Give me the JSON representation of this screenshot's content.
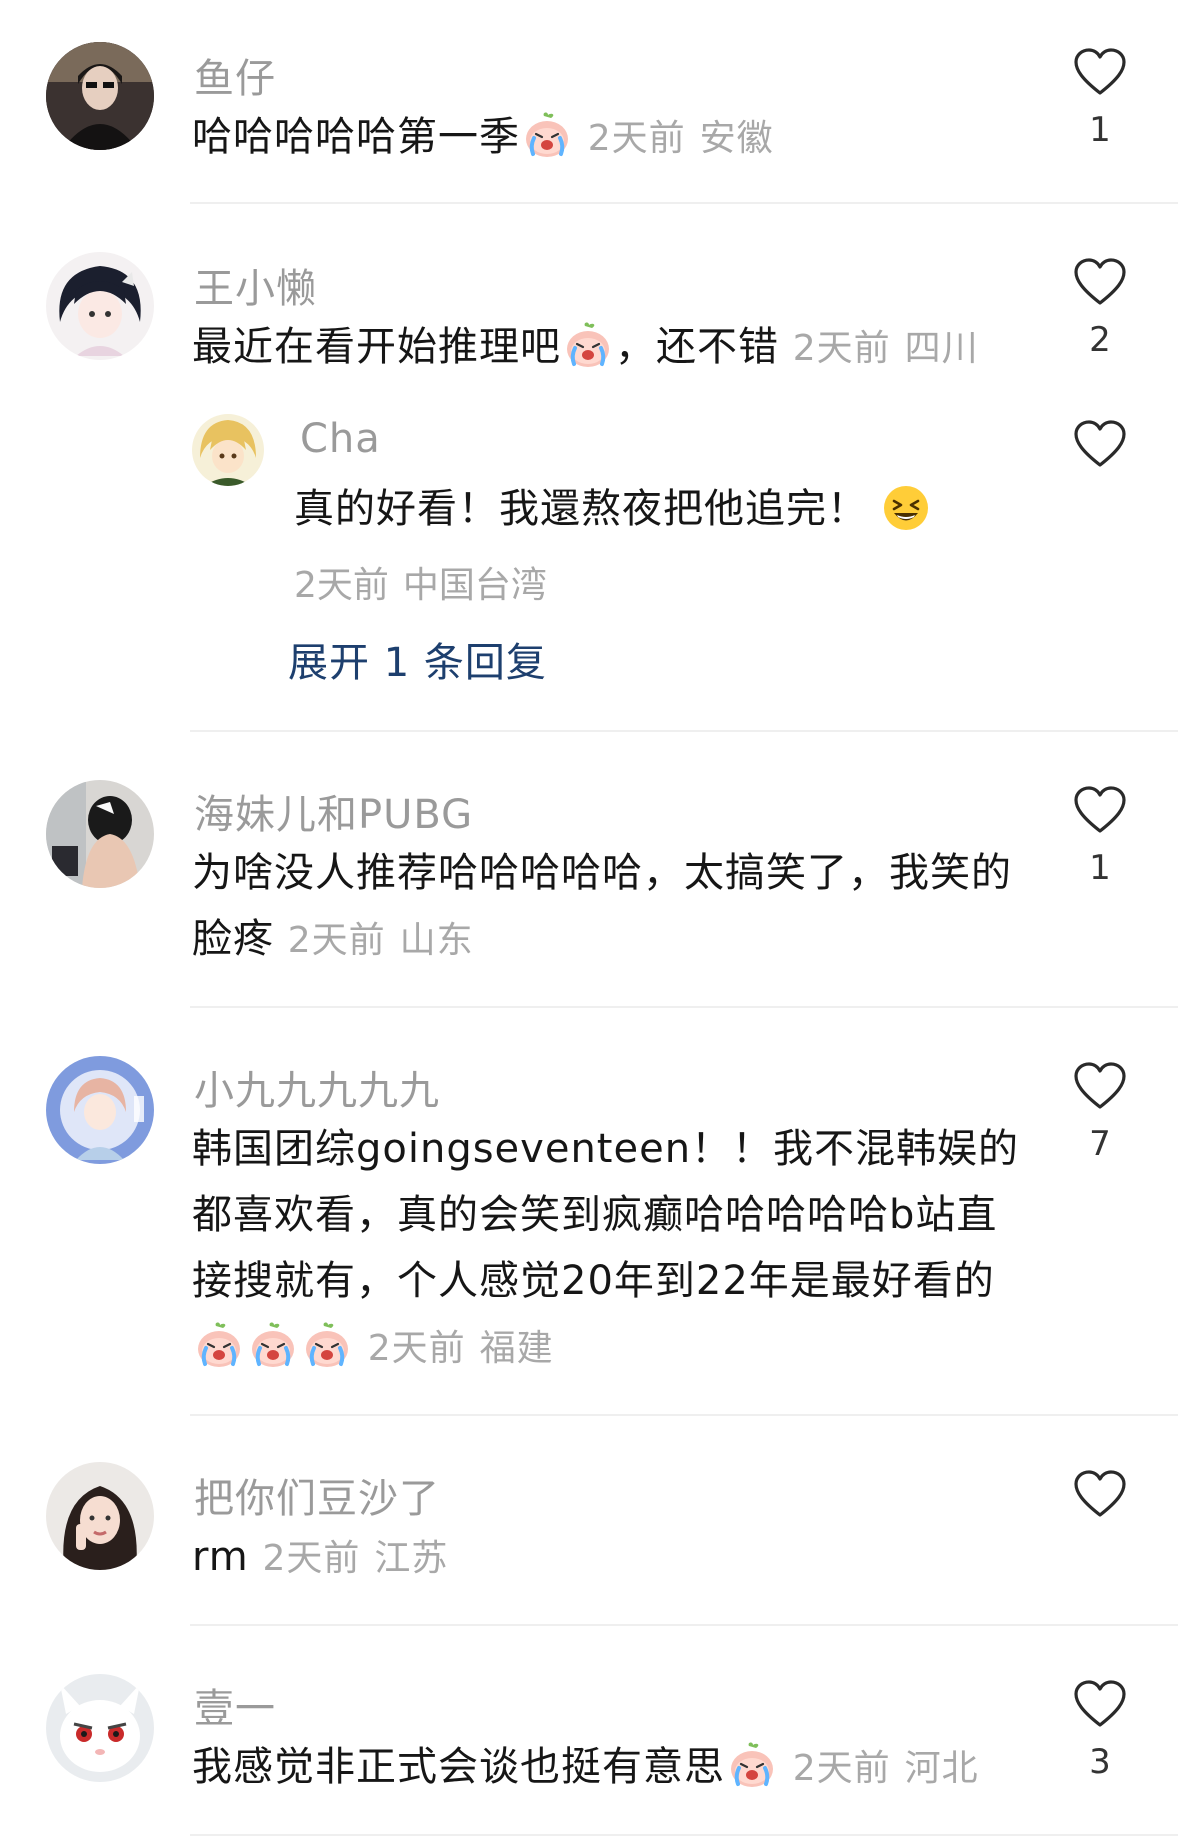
{
  "comments": [
    {
      "name": "鱼仔",
      "text": "哈哈哈哈哈第一季",
      "time": "2天前",
      "location": "安徽",
      "likes": "1"
    },
    {
      "name": "王小懒",
      "text": "最近在看开始推理吧",
      "text_after": "，还不错",
      "time": "2天前",
      "location": "四川",
      "likes": "2"
    },
    {
      "name": "海妹儿和PUBG",
      "text": "为啥没人推荐哈哈哈哈哈，太搞笑了，我笑的脸疼",
      "time": "2天前",
      "location": "山东",
      "likes": "1"
    },
    {
      "name": "小九九九九九",
      "text": "韩国团综goingseventeen！！我不混韩娱的都喜欢看，真的会笑到疯癫哈哈哈哈哈b站直接搜就有，个人感觉20年到22年是最好看的",
      "time": "2天前",
      "location": "福建",
      "likes": "7"
    },
    {
      "name": "把你们豆沙了",
      "text": "rm",
      "time": "2天前",
      "location": "江苏",
      "likes": ""
    },
    {
      "name": "壹一",
      "text": "我感觉非正式会谈也挺有意思",
      "time": "2天前",
      "location": "河北",
      "likes": "3"
    }
  ],
  "reply": {
    "name": "Cha",
    "text": "真的好看！我還熬夜把他追完！",
    "time": "2天前",
    "location": "中国台湾",
    "expand_label": "展开 1 条回复"
  },
  "icons": {
    "like": "heart-outline-icon",
    "emoji_cry": "crying-peach-emoji",
    "emoji_laugh": "grinning-squinting-face-emoji"
  },
  "colors": {
    "name": "#9a9a9a",
    "meta": "#a8a8a8",
    "link": "#1d3f6e",
    "divider": "#efefef"
  }
}
